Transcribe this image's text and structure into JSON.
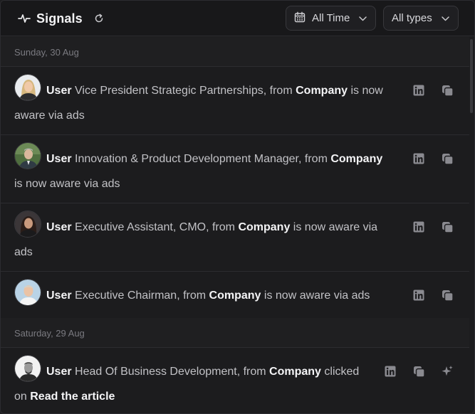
{
  "header": {
    "title": "Signals",
    "time_filter": "All Time",
    "type_filter": "All types"
  },
  "groups": [
    {
      "date": "Sunday, 30 Aug",
      "items": [
        {
          "user": "User",
          "role": "Vice President Strategic Partnerships, from",
          "company": "Company",
          "tail": "is now aware via ads"
        },
        {
          "user": "User",
          "role": "Innovation & Product Development Manager, from",
          "company": "Company",
          "tail": "is now aware via ads"
        },
        {
          "user": "User",
          "role": "Executive Assistant, CMO, from",
          "company": "Company",
          "tail": "is now aware via ads"
        },
        {
          "user": "User",
          "role": "Executive Chairman, from",
          "company": "Company",
          "tail": "is now aware via ads"
        }
      ]
    },
    {
      "date": "Saturday, 29 Aug",
      "items": [
        {
          "user": "User",
          "role": "Head Of Business Development, from",
          "company": "Company",
          "tail": "clicked on",
          "link": "Read the article"
        }
      ]
    }
  ],
  "colors": {
    "background": "#1c1c1e",
    "text_primary": "#f4f4f6",
    "text_secondary": "#c2c2c6",
    "muted": "#7a7a80",
    "border": "#2c2c30"
  },
  "icons": [
    "activity-icon",
    "refresh-icon",
    "calendar-icon",
    "chevron-down-icon",
    "linkedin-icon",
    "copy-icon",
    "sparkle-icon"
  ]
}
